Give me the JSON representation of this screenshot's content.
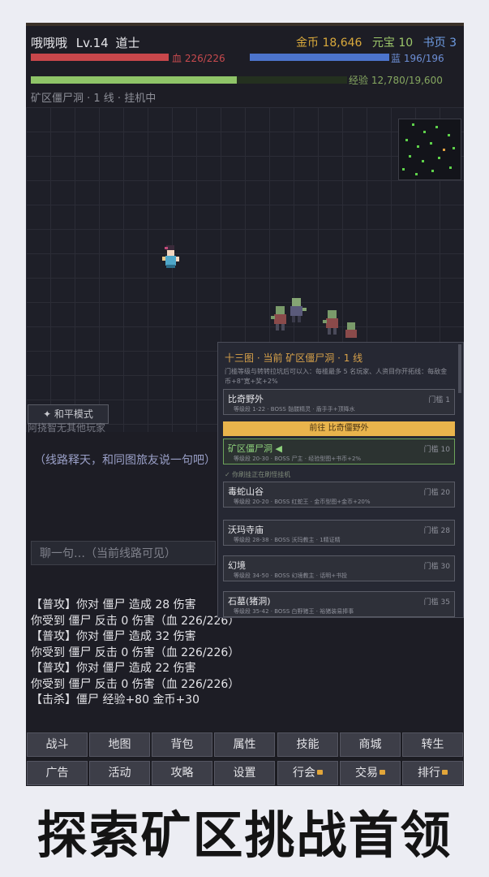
{
  "player": {
    "name": "哦哦哦",
    "level": "Lv.14",
    "class": "道士"
  },
  "currency": {
    "gold": "金币 18,646",
    "yuanbao": "元宝 10",
    "pages": "书页 3"
  },
  "stats": {
    "hp_text": "血 226/226",
    "hp_fraction": 1.0,
    "mp_text": "蓝 196/196",
    "mp_fraction": 1.0,
    "xp_text": "经验 12,780/19,600",
    "xp_fraction": 0.652
  },
  "location": "矿区僵尸洞 · 1 线 · 挂机中",
  "peace_mode": {
    "label": "✦ 和平模式",
    "hint": "阿挠智无其他玩家"
  },
  "chat": {
    "hint": "（线路释天，和同图旅友说一句吧）",
    "placeholder": "聊一句…（当前线路可见）"
  },
  "battle_log": [
    "【普攻】你对 僵尸 造成 28 伤害",
    "你受到 僵尸 反击 0 伤害（血 226/226）",
    "【普攻】你对 僵尸 造成 32 伤害",
    "你受到 僵尸 反击 0 伤害（血 226/226）",
    "【普攻】你对 僵尸 造成 22 伤害",
    "你受到 僵尸 反击 0 伤害（血 226/226）",
    "【击杀】僵尸 经验+80 金币+30"
  ],
  "panel": {
    "title": "十三图 · 当前 矿区僵尸洞 · 1 线",
    "desc": "门槛等级与转转拉坑后可以入：每槛最多 5 名玩家、人资目你开拓线：每敌金币+8\"宽+奖+2%",
    "goto_label": "前往 比奇僵野外",
    "auto_note": "✓ 你刷挂正在刷怪挂机",
    "zones": [
      {
        "name": "比奇野外",
        "sub": "等级段 1-22 · BOSS 骷髅精灵 · 盾手手+顶降水",
        "tier": "门槛 1"
      },
      {
        "name": "矿区僵尸洞 ◀",
        "sub": "等级段 20-30 · BOSS 尸主 · 经验型图+书币+2%",
        "tier": "门槛 10"
      },
      {
        "name": "毒蛇山谷",
        "sub": "等级段 20-20 · BOSS 红蛇王 · 金币型图+金币+20%",
        "tier": "门槛 20"
      },
      {
        "name": "沃玛寺庙",
        "sub": "等级段 28-38 · BOSS 沃玛教主 · 1精证精",
        "tier": "门槛 28"
      },
      {
        "name": "幻境",
        "sub": "等级段 34-50 · BOSS 幻境教主 · 话明+书投",
        "tier": "门槛 30"
      },
      {
        "name": "石墓(猪洞)",
        "sub": "等级段 35-42 · BOSS 白野猪王 · 裕猪装易捧事",
        "tier": "门槛 35"
      }
    ]
  },
  "menu_row1": [
    "战斗",
    "地图",
    "背包",
    "属性",
    "技能",
    "商城",
    "转生"
  ],
  "menu_row2": [
    "广告",
    "活动",
    "攻略",
    "设置",
    "行会",
    "交易",
    "排行"
  ],
  "menu_row2_locked": [
    false,
    false,
    false,
    false,
    true,
    true,
    true
  ],
  "banner": "探索矿区挑战首领",
  "colors": {
    "hp": "#c8474b",
    "mp": "#4c74cc",
    "xp": "#8fc468",
    "gold": "#d9a93c",
    "accent_button": "#e9b44c"
  }
}
